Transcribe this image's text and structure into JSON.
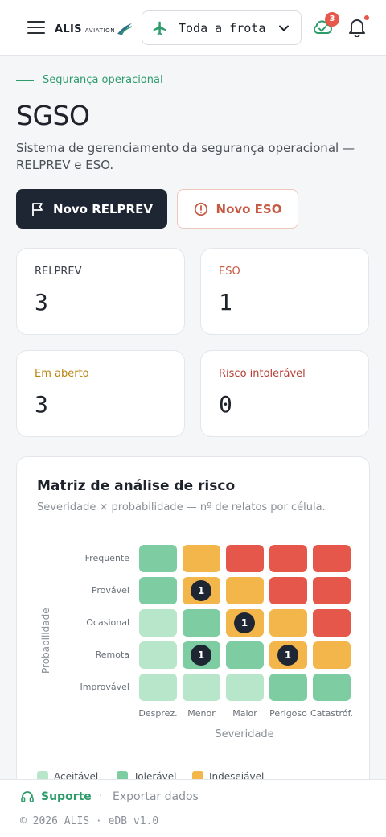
{
  "header": {
    "logo_main": "ALIS",
    "logo_sub": "AVIATION",
    "fleet_selector": "Toda a frota",
    "sync_badge": "3"
  },
  "page": {
    "eyebrow": "Segurança operacional",
    "title": "SGSO",
    "description": "Sistema de gerenciamento da segurança operacional — RELPREV e ESO."
  },
  "actions": {
    "new_relprev": "Novo RELPREV",
    "new_eso": "Novo ESO"
  },
  "kpis": [
    {
      "label": "RELPREV",
      "value": "3",
      "color": "#3a4049"
    },
    {
      "label": "ESO",
      "value": "1",
      "color": "#c65a43"
    },
    {
      "label": "Em aberto",
      "value": "3",
      "color": "#b7850f"
    },
    {
      "label": "Risco intolerável",
      "value": "0",
      "color": "#b53c32"
    }
  ],
  "matrix": {
    "title": "Matriz de análise de risco",
    "subtitle": "Severidade × probabilidade — nº de relatos por célula.",
    "y_axis": "Probabilidade",
    "x_axis": "Severidade",
    "rows": [
      "Frequente",
      "Provável",
      "Ocasional",
      "Remota",
      "Improvável"
    ],
    "columns": [
      "Desprez.",
      "Menor",
      "Maior",
      "Perigoso",
      "Catastróf."
    ],
    "levels": [
      [
        "T",
        "U",
        "I",
        "I",
        "I"
      ],
      [
        "T",
        "U",
        "U",
        "I",
        "I"
      ],
      [
        "A",
        "T",
        "U",
        "U",
        "I"
      ],
      [
        "A",
        "T",
        "T",
        "U",
        "U"
      ],
      [
        "A",
        "A",
        "A",
        "T",
        "T"
      ]
    ],
    "counts": [
      [
        "",
        "",
        "",
        "",
        ""
      ],
      [
        "",
        "1",
        "",
        "",
        ""
      ],
      [
        "",
        "",
        "1",
        "",
        ""
      ],
      [
        "",
        "1",
        "",
        "1",
        ""
      ],
      [
        "",
        "",
        "",
        "",
        ""
      ]
    ],
    "colors": {
      "A": "#b8e6cb",
      "T": "#7dcca2",
      "U": "#f2b64a",
      "I": "#e5574b"
    },
    "legend": [
      {
        "label": "Aceitável",
        "color": "#b8e6cb"
      },
      {
        "label": "Tolerável",
        "color": "#7dcca2"
      },
      {
        "label": "Indesejável",
        "color": "#f2b64a"
      }
    ]
  },
  "footer": {
    "support": "Suporte",
    "separator": "·",
    "export": "Exportar dados",
    "copyright": "© 2026 ALIS · eDB v1.0"
  }
}
